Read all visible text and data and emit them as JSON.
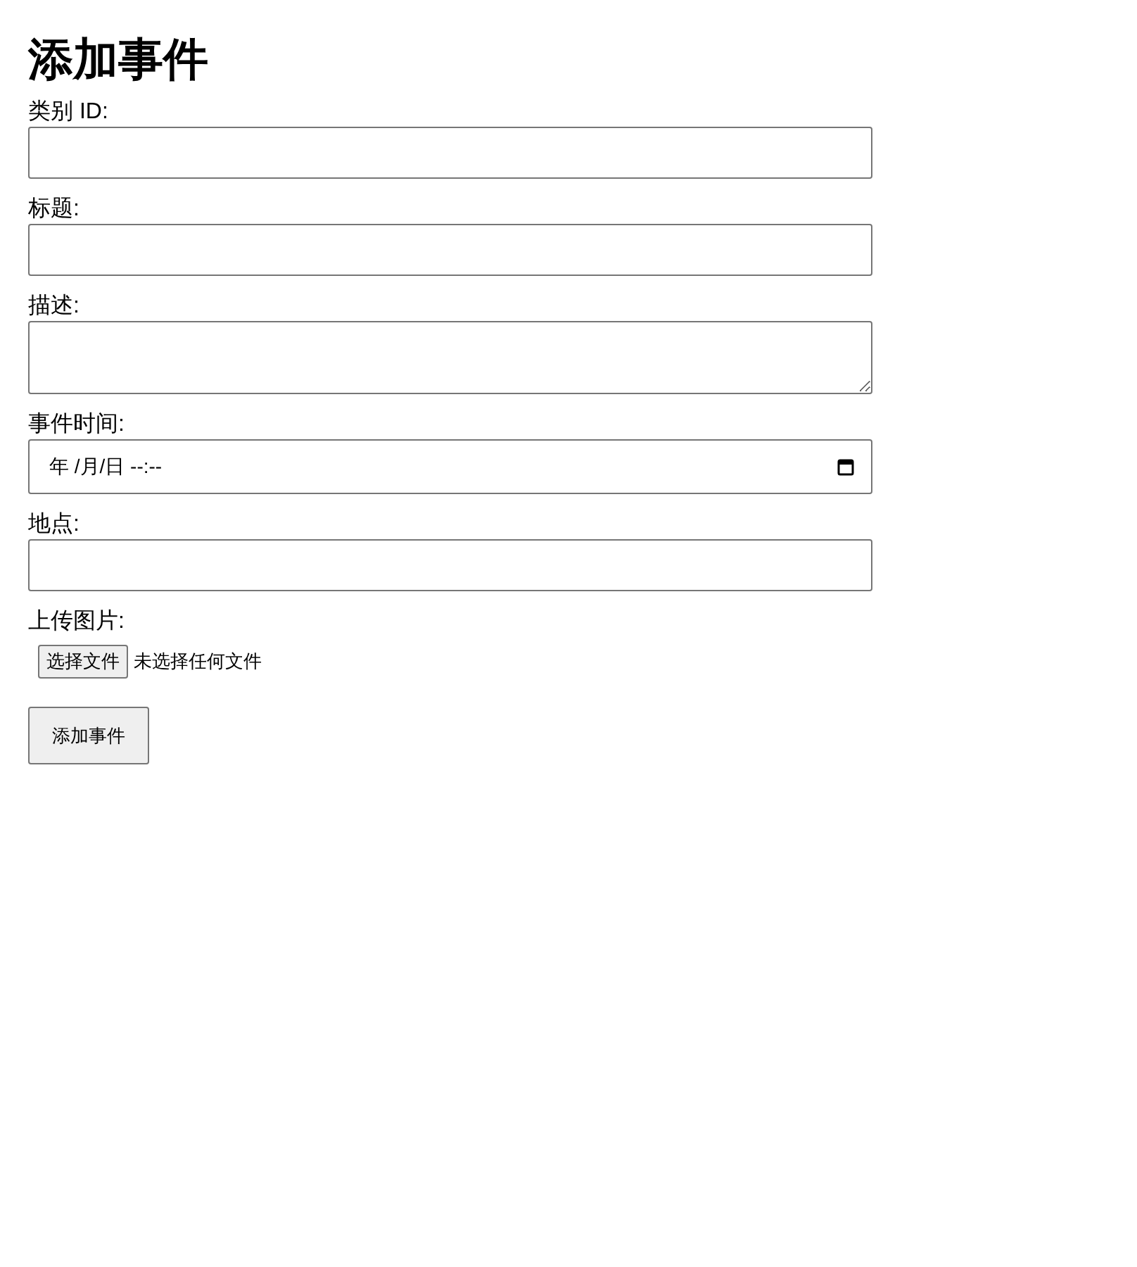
{
  "title": "添加事件",
  "fields": [
    {
      "kind": "text",
      "label": "类别 ID:"
    },
    {
      "kind": "text",
      "label": "标题:"
    },
    {
      "kind": "textarea",
      "label": "描述:"
    },
    {
      "kind": "datetime",
      "label": "事件时间:",
      "placeholder": "年 /月/日 --:--"
    },
    {
      "kind": "text",
      "label": "地点:"
    },
    {
      "kind": "file",
      "label": "上传图片:",
      "button": "选择文件",
      "status": "未选择任何文件"
    }
  ],
  "submit": "添加事件"
}
